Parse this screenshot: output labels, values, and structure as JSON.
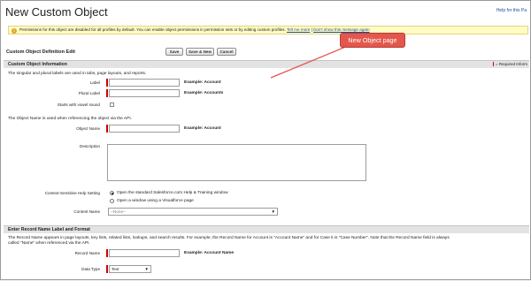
{
  "header": {
    "title": "New Custom Object",
    "help_link": "Help for this Pa"
  },
  "info_bar": {
    "message": "Permissions for this object are disabled for all profiles by default. You can enable object permissions in permission sets or by editing custom profiles.",
    "link_text": "Tell me more",
    "dismiss_text": "Don't show this message again"
  },
  "edit_header": "Custom Object Definition Edit",
  "buttons": {
    "save": "Save",
    "save_new": "Save & New",
    "cancel": "Cancel"
  },
  "callout": {
    "text": "New Object page",
    "color": "#e4574c"
  },
  "section_info": {
    "title": "Custom Object Information",
    "required_info": "= Required Inform",
    "labels_desc": "The singular and plural labels are used in tabs, page layouts, and reports.",
    "label_label": "Label",
    "label_example": "Example:  Account",
    "plural_label": "Plural Label",
    "plural_example": "Example:  Accounts",
    "vowel_label": "Starts with vowel sound",
    "api_desc": "The Object Name is used when referencing the object via the API.",
    "object_name_label": "Object Name",
    "object_name_example": "Example:  Account",
    "description_label": "Description",
    "help_setting_label": "Context-Sensitive Help Setting",
    "help_option_1": "Open the standard Salesforce.com Help & Training window",
    "help_option_2": "Open a window using a Visualforce page",
    "content_name_label": "Content Name",
    "content_name_value": "--None--"
  },
  "section_record": {
    "title": "Enter Record Name Label and Format",
    "desc_line1": "The Record Name appears in page layouts, key lists, related lists, lookups, and search results. For example, the Record Name for Account is \"Account Name\" and for Case it is \"Case Number\". Note that the Record Name field is always",
    "desc_line2": "called \"Name\" when referenced via the API.",
    "record_name_label": "Record Name",
    "record_name_example": "Example:  Account Name",
    "data_type_label": "Data Type",
    "data_type_value": "Text"
  }
}
